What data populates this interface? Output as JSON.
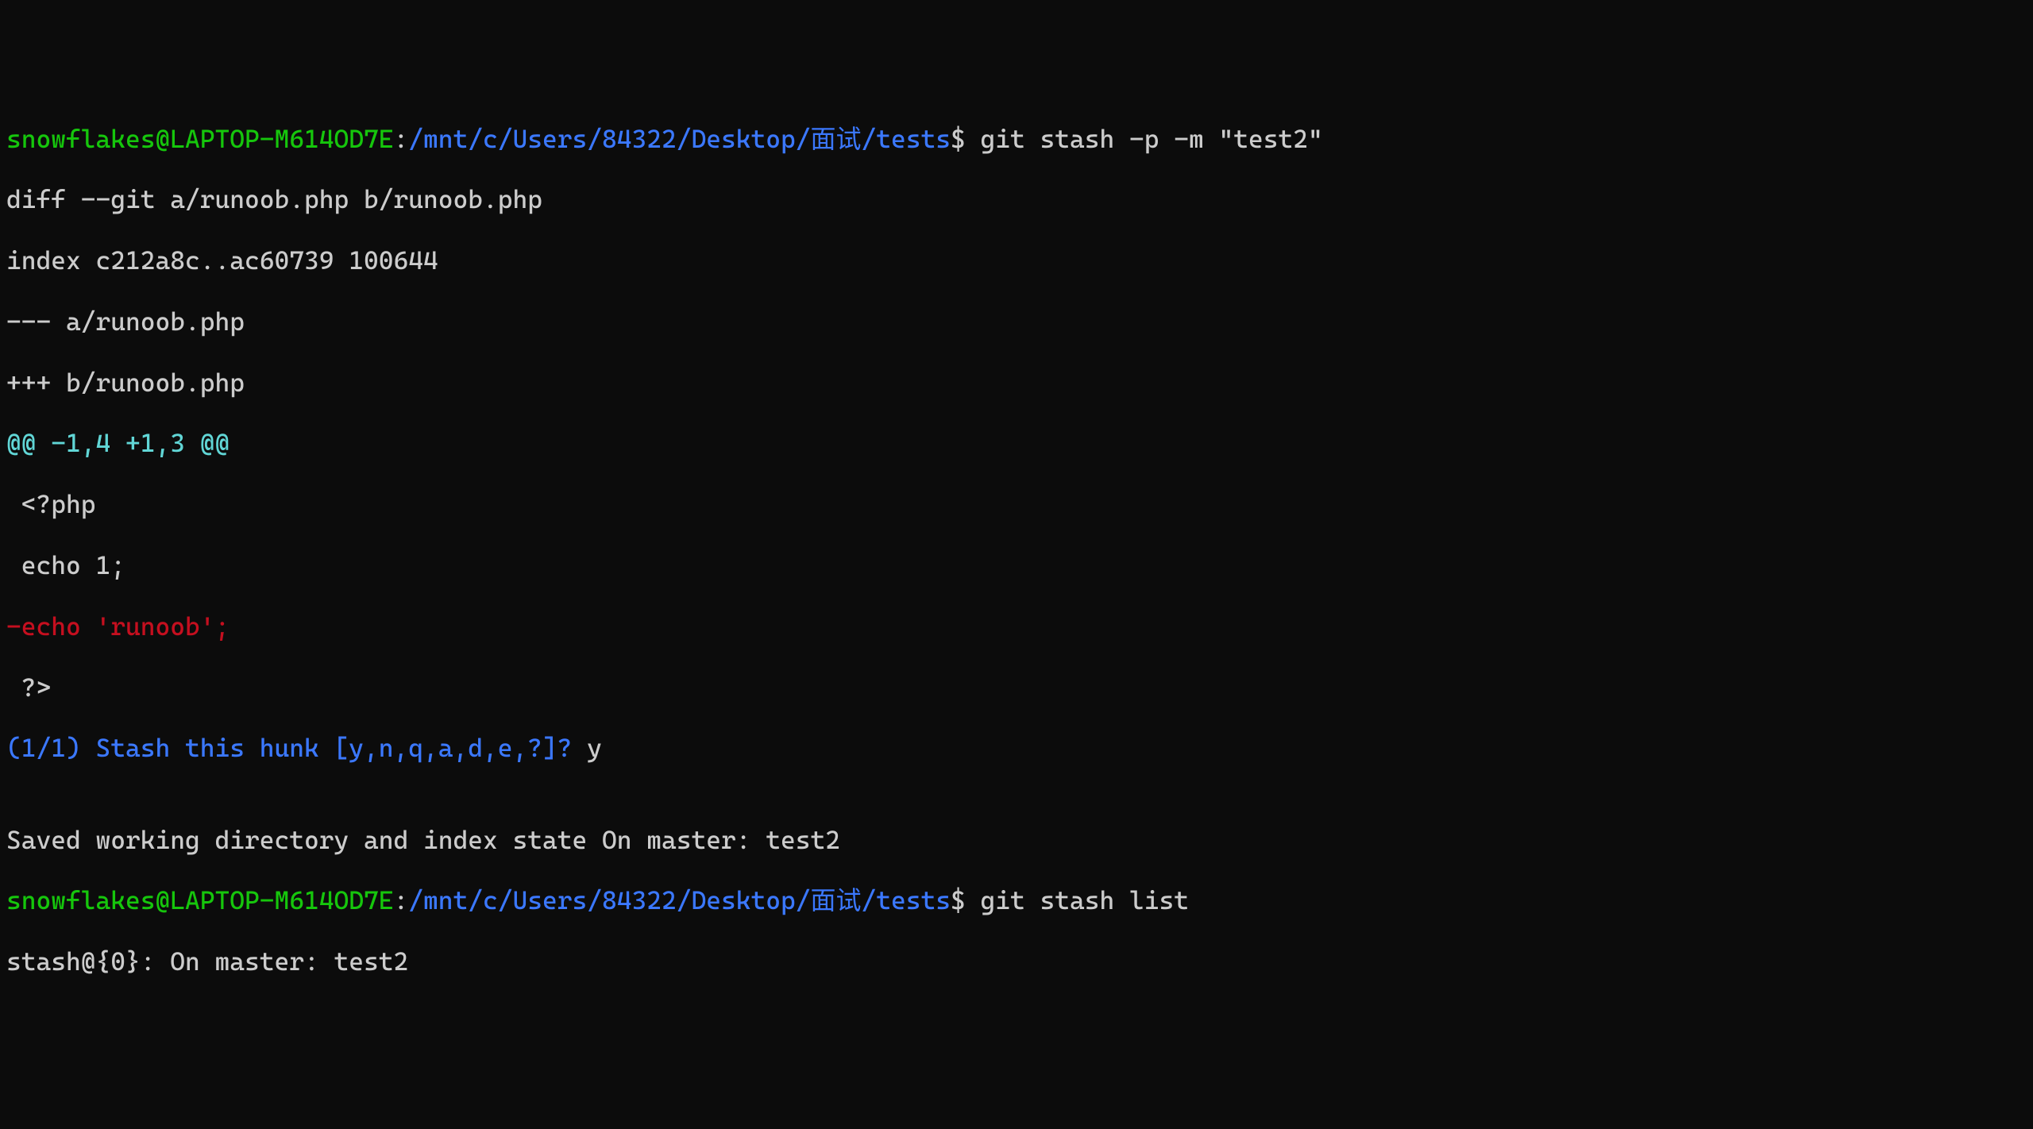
{
  "prompt1": {
    "user_host": "snowflakes@LAPTOP-M614OD7E",
    "colon": ":",
    "path": "/mnt/c/Users/84322/Desktop/面试/tests",
    "dollar": "$ ",
    "command": "git stash -p -m \"test2\""
  },
  "diff_header": "diff --git a/runoob.php b/runoob.php",
  "index_line": "index c212a8c..ac60739 100644",
  "file_old": "--- a/runoob.php",
  "file_new": "+++ b/runoob.php",
  "hunk_header": "@@ -1,4 +1,3 @@",
  "context1": " <?php",
  "context2": " echo 1;",
  "removed": "-echo 'runoob';",
  "context3": " ?>",
  "stash_prompt": "(1/1) Stash this hunk [y,n,q,a,d,e,?]? ",
  "stash_answer": "y",
  "blank": "",
  "saved_msg": "Saved working directory and index state On master: test2",
  "prompt2": {
    "user_host": "snowflakes@LAPTOP-M614OD7E",
    "colon": ":",
    "path": "/mnt/c/Users/84322/Desktop/面试/tests",
    "dollar": "$ ",
    "command": "git stash list"
  },
  "stash_list_out": "stash@{0}: On master: test2"
}
